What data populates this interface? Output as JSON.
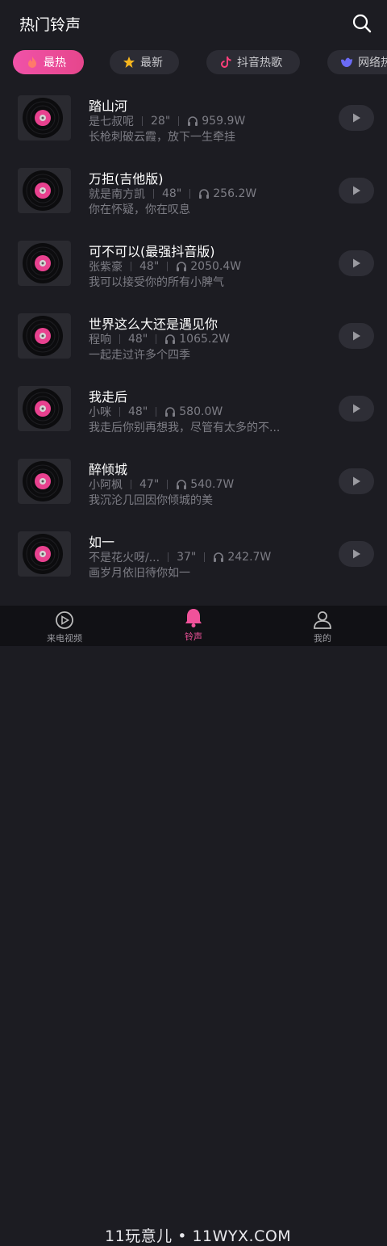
{
  "header": {
    "title": "热门铃声"
  },
  "tabs": [
    {
      "label": "最热",
      "icon": "flame-icon",
      "active": true
    },
    {
      "label": "最新",
      "icon": "star-icon",
      "active": false
    },
    {
      "label": "抖音热歌",
      "icon": "tiktok-icon",
      "active": false
    },
    {
      "label": "网络热",
      "icon": "web-icon",
      "active": false
    }
  ],
  "songs": [
    {
      "title": "踏山河",
      "artist": "是七叔呢",
      "duration": "28\"",
      "plays": "959.9W",
      "lyric": "长枪刺破云霞，放下一生牵挂"
    },
    {
      "title": "万拒(吉他版)",
      "artist": "就是南方凯",
      "duration": "48\"",
      "plays": "256.2W",
      "lyric": "你在怀疑，你在叹息"
    },
    {
      "title": "可不可以(最强抖音版)",
      "artist": "张紫豪",
      "duration": "48\"",
      "plays": "2050.4W",
      "lyric": "我可以接受你的所有小脾气"
    },
    {
      "title": "世界这么大还是遇见你",
      "artist": "程响",
      "duration": "48\"",
      "plays": "1065.2W",
      "lyric": "一起走过许多个四季"
    },
    {
      "title": "我走后",
      "artist": "小咪",
      "duration": "48\"",
      "plays": "580.0W",
      "lyric": "我走后你别再想我，尽管有太多的不..."
    },
    {
      "title": "醉倾城",
      "artist": "小阿枫",
      "duration": "47\"",
      "plays": "540.7W",
      "lyric": "我沉沦几回因你倾城的美"
    },
    {
      "title": "如一",
      "artist": "不是花火呀/...",
      "duration": "37\"",
      "plays": "242.7W",
      "lyric": "画岁月依旧待你如一"
    }
  ],
  "nav": [
    {
      "label": "来电视频",
      "icon": "video-icon",
      "active": false
    },
    {
      "label": "铃声",
      "icon": "bell-icon",
      "active": true
    },
    {
      "label": "我的",
      "icon": "user-icon",
      "active": false
    }
  ],
  "watermark": "11玩意儿 • 11WYX.COM",
  "colors": {
    "accent": "#f0529a",
    "background": "#1c1c22",
    "secondary_text": "#7d7d85"
  }
}
